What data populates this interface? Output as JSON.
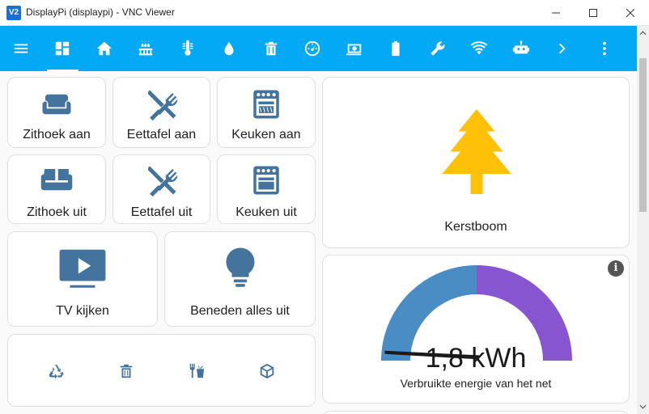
{
  "window": {
    "title": "DisplayPi (displaypi) - VNC Viewer",
    "app_icon": "V2",
    "controls": [
      "minimize-icon",
      "maximize-icon",
      "close-icon"
    ]
  },
  "toolbar": {
    "accent": "#03a9f4",
    "items": [
      {
        "icon": "menu-icon"
      },
      {
        "icon": "dashboard-icon",
        "active": true
      },
      {
        "icon": "home-icon"
      },
      {
        "icon": "radiator-icon"
      },
      {
        "icon": "thermometer-icon"
      },
      {
        "icon": "water-drop-icon"
      },
      {
        "icon": "trash-can-icon"
      },
      {
        "icon": "gauge-icon"
      },
      {
        "icon": "cash-icon"
      },
      {
        "icon": "battery-icon"
      },
      {
        "icon": "wrench-icon"
      },
      {
        "icon": "wifi-icon"
      },
      {
        "icon": "robot-icon"
      },
      {
        "icon": "chevron-right-icon"
      },
      {
        "icon": "more-vertical-icon"
      }
    ]
  },
  "buttons": {
    "zithoek_aan": "Zithoek aan",
    "eettafel_aan": "Eettafel aan",
    "keuken_aan": "Keuken aan",
    "zithoek_uit": "Zithoek uit",
    "eettafel_uit": "Eettafel uit",
    "keuken_uit": "Keuken uit",
    "tv_kijken": "TV kijken",
    "beneden_alles_uit": "Beneden alles uit",
    "kerstboom": "Kerstboom"
  },
  "icon_color": "#44739e",
  "tree_color": "#ffc107",
  "waste_row": {
    "icons": [
      "recycle-icon",
      "trash-icon",
      "food-waste-icon",
      "package-icon"
    ]
  },
  "gauge": {
    "value_text": "1,8 kWh",
    "label": "Verbruikte energie van het net",
    "fraction": 0.5,
    "colors": {
      "left": "#4a8cc4",
      "right": "#8855d0"
    },
    "info_icon": "i"
  }
}
